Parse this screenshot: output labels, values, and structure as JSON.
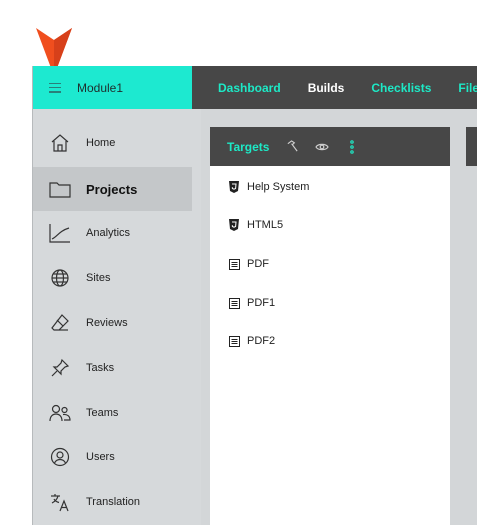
{
  "header": {
    "module_name": "Module1"
  },
  "topnav": {
    "tabs": [
      {
        "label": "Dashboard",
        "active": false
      },
      {
        "label": "Builds",
        "active": true
      },
      {
        "label": "Checklists",
        "active": false
      },
      {
        "label": "Files",
        "active": false
      }
    ]
  },
  "sidebar": {
    "items": [
      {
        "label": "Home",
        "icon": "home-icon",
        "active": false
      },
      {
        "label": "Projects",
        "icon": "folder-icon",
        "active": true
      },
      {
        "label": "Analytics",
        "icon": "analytics-icon",
        "active": false
      },
      {
        "label": "Sites",
        "icon": "globe-icon",
        "active": false
      },
      {
        "label": "Reviews",
        "icon": "eraser-icon",
        "active": false
      },
      {
        "label": "Tasks",
        "icon": "pin-icon",
        "active": false
      },
      {
        "label": "Teams",
        "icon": "team-icon",
        "active": false
      },
      {
        "label": "Users",
        "icon": "user-circle-icon",
        "active": false
      },
      {
        "label": "Translation",
        "icon": "translate-icon",
        "active": false
      }
    ]
  },
  "panel": {
    "title": "Targets",
    "toolbar_icons": [
      "hammer-icon",
      "eye-icon",
      "more-vertical-icon"
    ],
    "targets": [
      {
        "label": "Help System",
        "icon": "html5-icon"
      },
      {
        "label": "HTML5",
        "icon": "html5-icon"
      },
      {
        "label": "PDF",
        "icon": "pdf-icon"
      },
      {
        "label": "PDF1",
        "icon": "pdf-icon"
      },
      {
        "label": "PDF2",
        "icon": "pdf-icon"
      }
    ]
  },
  "colors": {
    "accent": "#1de9c6",
    "module_bar": "#1de9d0",
    "dark_bar": "#474747",
    "sidebar": "#d6d9db",
    "pointer": "#f04e1e"
  }
}
